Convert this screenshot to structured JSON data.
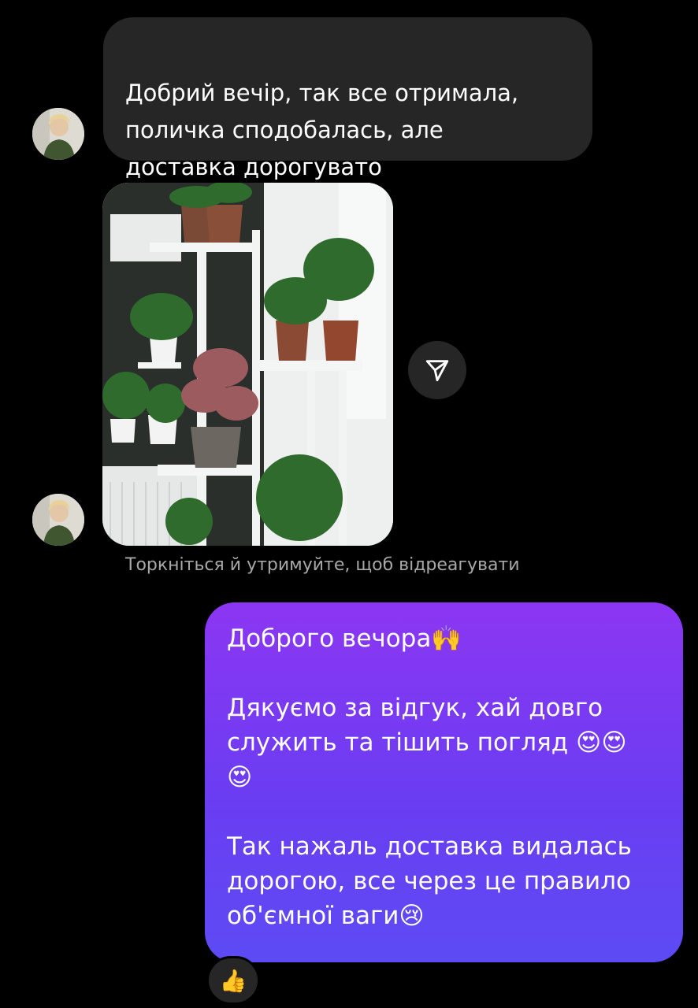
{
  "messages": {
    "incoming_text": "Добрий вечір, так все отримала,\nполичка сподобалась, але\nдоставка дорогувато",
    "hint": "Торкніться й утримуйте, щоб відреагувати",
    "outgoing_paragraphs": [
      "Доброго вечора🙌",
      "Дякуємо за відгук, хай довго\nслужить та тішить погляд 😍😍\n😍",
      "Так нажаль доставка видалась\nдорогою, все через це правило\nоб'ємної ваги😢"
    ],
    "reaction_emoji": "👍"
  },
  "icons": {
    "share": "paper-plane-icon",
    "avatar": "user-avatar"
  },
  "colors": {
    "background": "#000000",
    "incoming_bubble": "#262626",
    "outgoing_gradient_top": "#8c36f2",
    "outgoing_gradient_bottom": "#5d4bf4",
    "hint_text": "#a8a8a8"
  }
}
